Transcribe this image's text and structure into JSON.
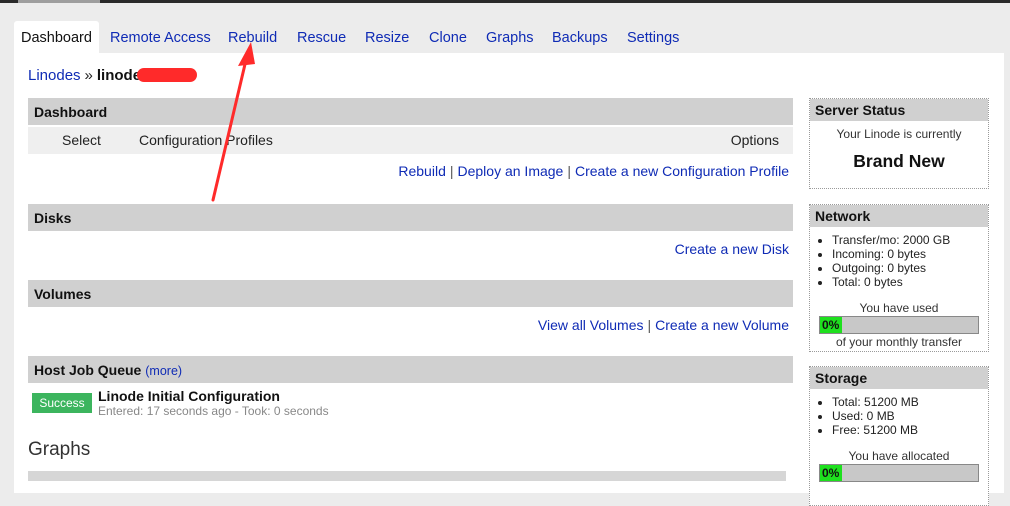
{
  "tabs": [
    {
      "label": "Dashboard"
    },
    {
      "label": "Remote Access"
    },
    {
      "label": "Rebuild"
    },
    {
      "label": "Rescue"
    },
    {
      "label": "Resize"
    },
    {
      "label": "Clone"
    },
    {
      "label": "Graphs"
    },
    {
      "label": "Backups"
    },
    {
      "label": "Settings"
    }
  ],
  "breadcrumb": {
    "root": "Linodes",
    "separator": "»",
    "current": "linode"
  },
  "dashboard": {
    "title": "Dashboard",
    "columns": [
      "Select",
      "Configuration Profiles",
      "Options"
    ],
    "links": [
      "Rebuild",
      "Deploy an Image",
      "Create a new Configuration Profile"
    ]
  },
  "disks": {
    "title": "Disks",
    "links": [
      "Create a new Disk"
    ]
  },
  "volumes": {
    "title": "Volumes",
    "links": [
      "View all Volumes",
      "Create a new Volume"
    ]
  },
  "host_job_queue": {
    "title": "Host Job Queue",
    "more_link": "(more)",
    "job": {
      "status": "Success",
      "title": "Linode Initial Configuration",
      "meta": "Entered: 17 seconds ago - Took: 0 seconds"
    }
  },
  "graphs": {
    "title": "Graphs"
  },
  "server_status": {
    "title": "Server Status",
    "line": "Your Linode is currently",
    "state": "Brand New"
  },
  "network": {
    "title": "Network",
    "stats": [
      "Transfer/mo: 2000 GB",
      "Incoming: 0 bytes",
      "Outgoing: 0 bytes",
      "Total: 0 bytes"
    ],
    "used_label": "You have used",
    "meter_value": 0,
    "meter_text": "0%",
    "meter_caption": "of your monthly transfer"
  },
  "storage": {
    "title": "Storage",
    "stats": [
      "Total: 51200 MB",
      "Used: 0 MB",
      "Free: 51200 MB"
    ],
    "allocated_label": "You have allocated",
    "meter_value": 0,
    "meter_text": "0%"
  },
  "colors": {
    "accent_link": "#0f2bb5",
    "success": "#3cb55e",
    "meter_fill": "#1ee01e",
    "annotation_arrow": "#ff2a2a",
    "redaction": "#ff2a2a"
  }
}
